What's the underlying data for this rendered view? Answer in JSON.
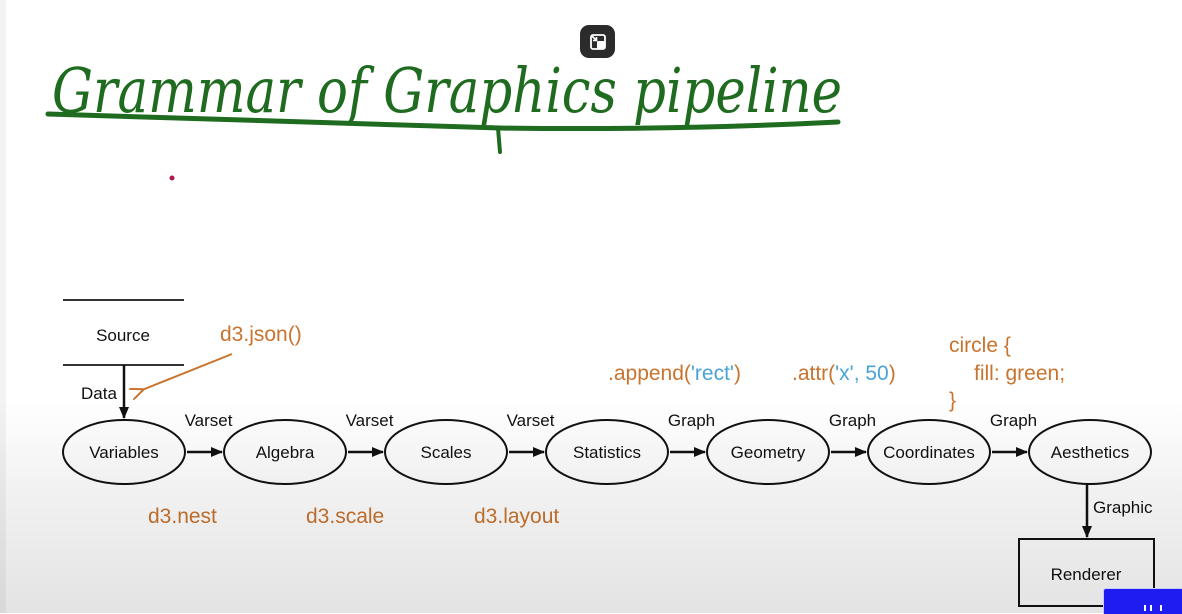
{
  "title": "Grammar of Graphics pipeline",
  "controls": {
    "exit_icon": "exit-fullscreen-icon",
    "corner_icon": "grip-icon"
  },
  "colors": {
    "handwriting": "#1f6b1f",
    "code": "#c8732e",
    "code_blue": "#4aa3d6",
    "dot": "#b0194a"
  },
  "diagram": {
    "source": "Source",
    "data_label": "Data",
    "annotation": "d3.json()",
    "nodes": [
      "Variables",
      "Algebra",
      "Scales",
      "Statistics",
      "Geometry",
      "Coordinates",
      "Aesthetics"
    ],
    "edges": [
      "Varset",
      "Varset",
      "Varset",
      "Graph",
      "Graph",
      "Graph"
    ],
    "code_below": [
      "d3.nest",
      "d3.scale",
      "d3.layout"
    ],
    "code_above": {
      "append_prefix": ".append(",
      "append_arg": "'rect'",
      "append_suffix": ")",
      "attr_prefix": ".attr(",
      "attr_arg": "'x', 50",
      "attr_suffix": ")",
      "css_open": "circle {",
      "css_body": "fill: green;",
      "css_close": "}"
    },
    "graphic_label": "Graphic",
    "renderer": "Renderer"
  }
}
